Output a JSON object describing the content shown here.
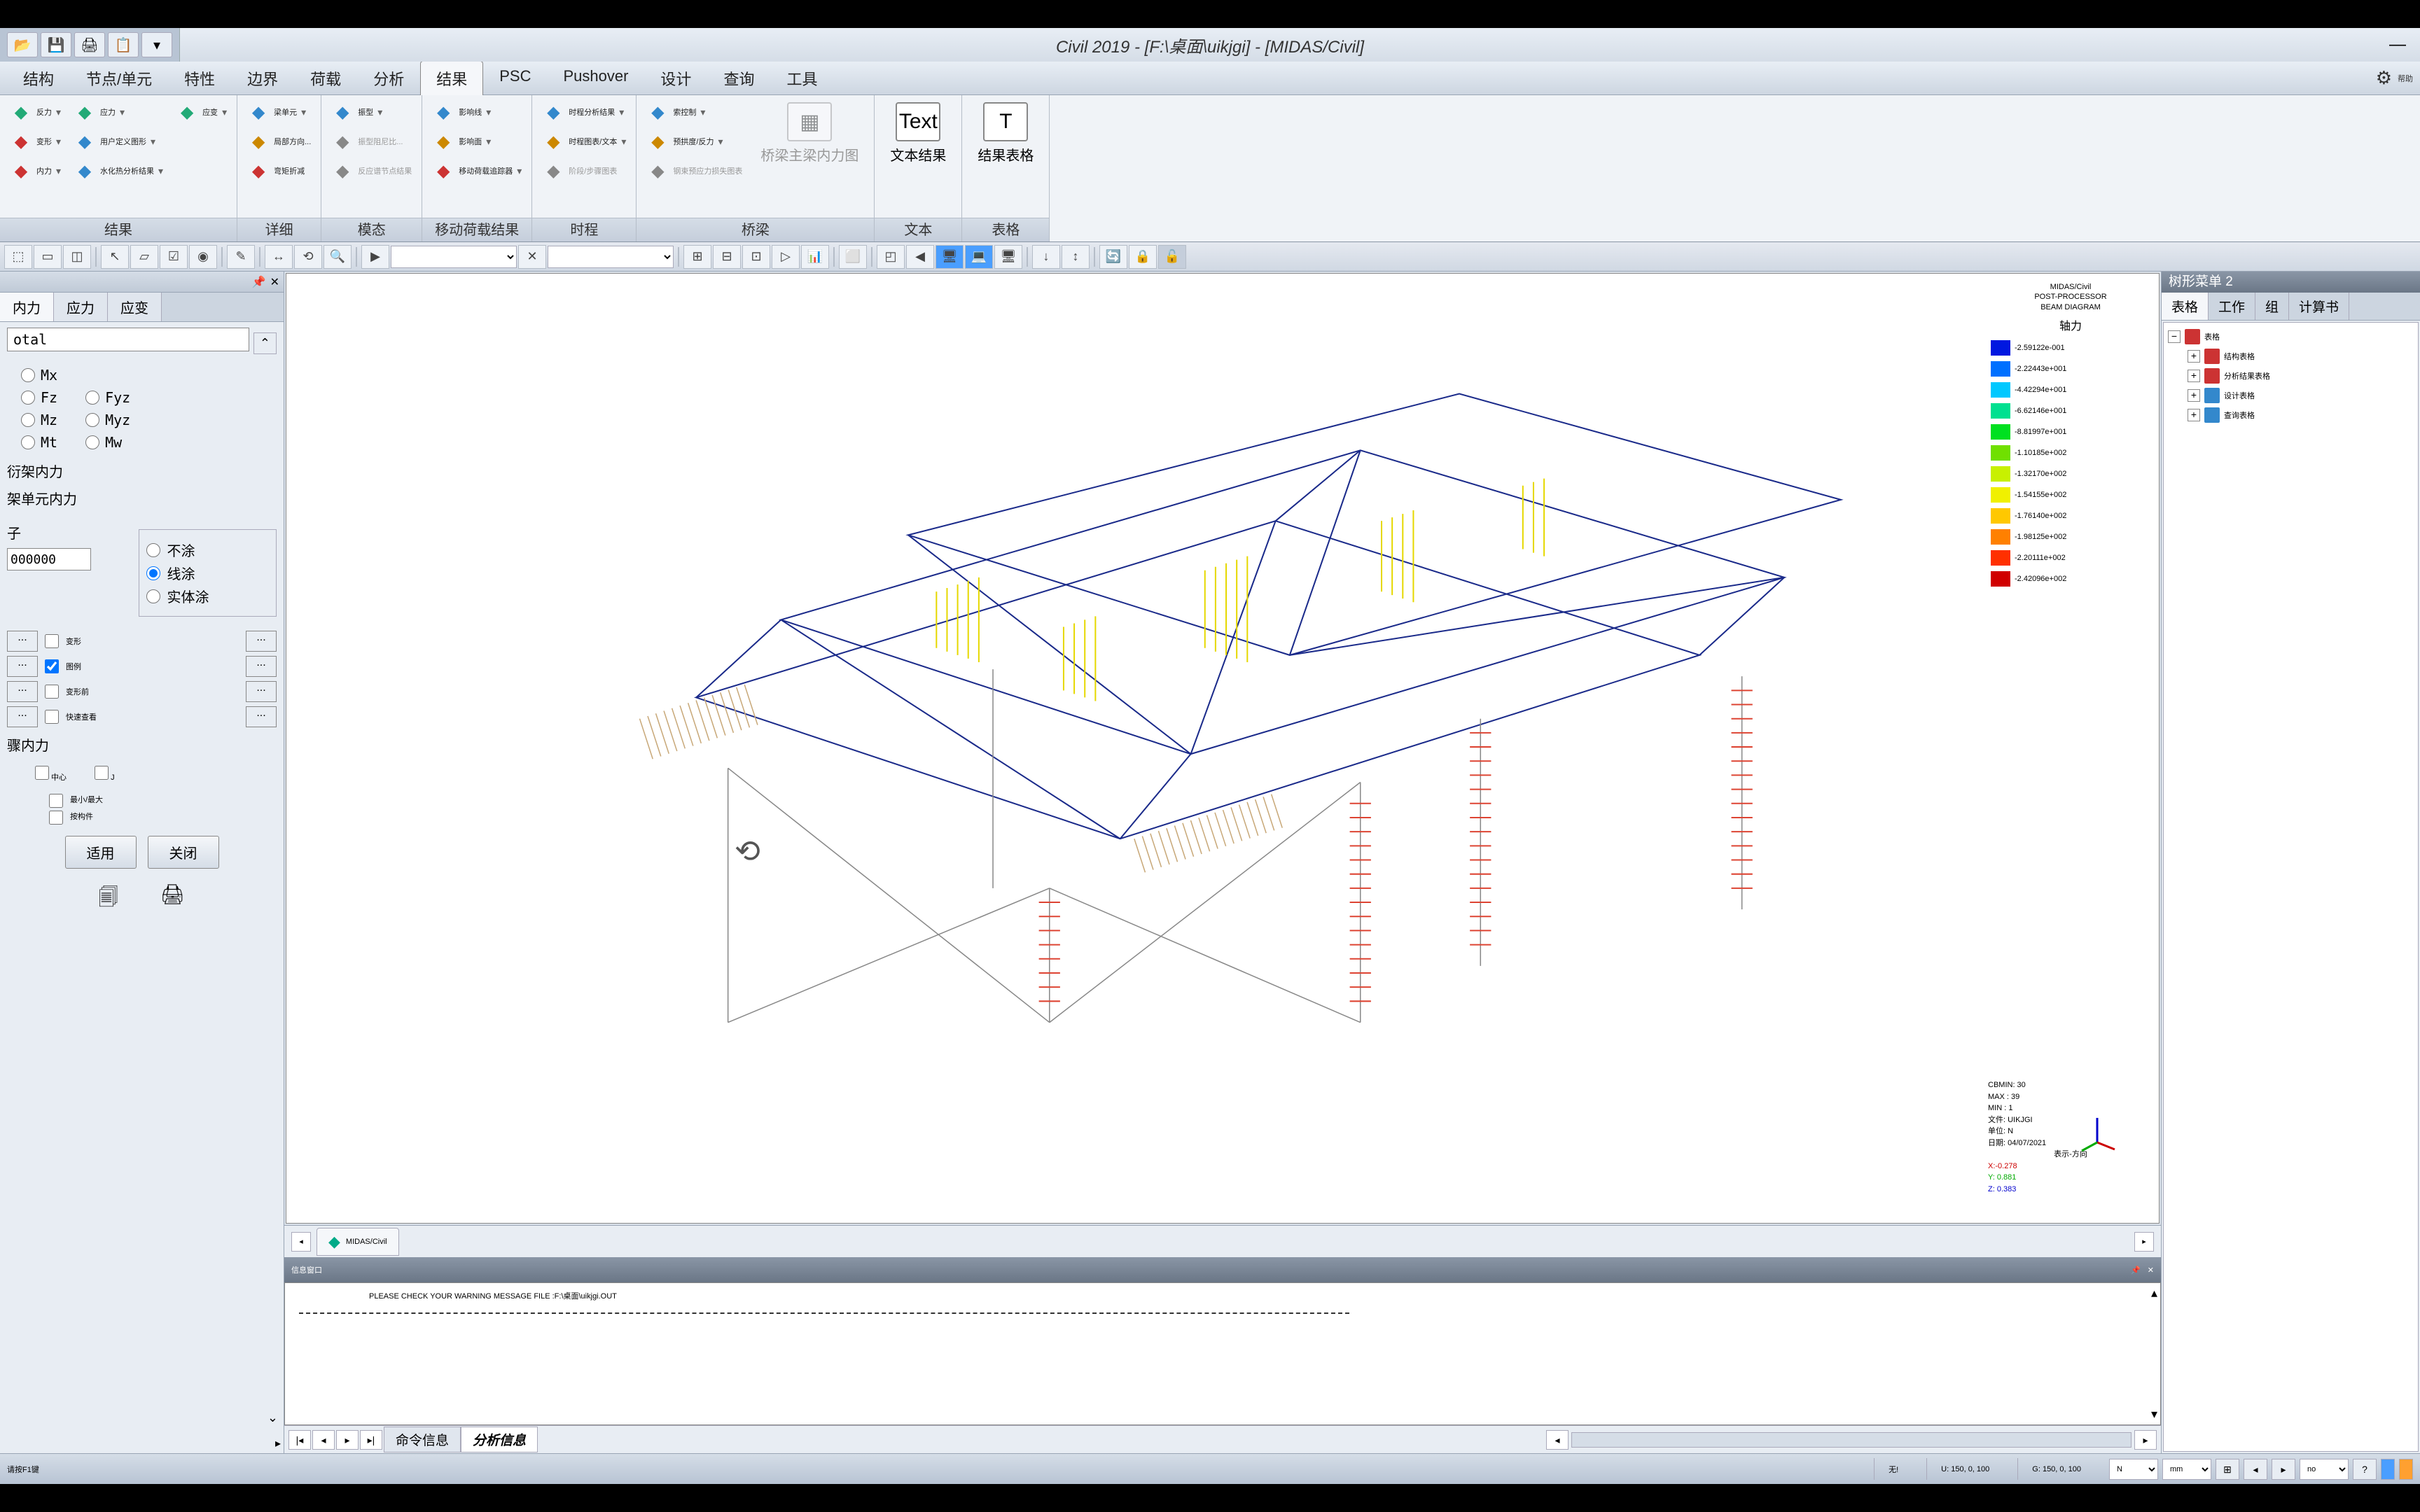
{
  "title": "Civil 2019 - [F:\\桌面\\uikjgi] - [MIDAS/Civil]",
  "menu": [
    "结构",
    "节点/单元",
    "特性",
    "边界",
    "荷载",
    "分析",
    "结果",
    "PSC",
    "Pushover",
    "设计",
    "查询",
    "工具"
  ],
  "menu_active": 6,
  "help_label": "帮助",
  "ribbon": {
    "groups": [
      {
        "label": "结果",
        "items": [
          {
            "col": [
              {
                "t": "反力",
                "dd": 1,
                "c": "#2a7"
              },
              {
                "t": "变形",
                "dd": 1,
                "c": "#c33"
              },
              {
                "t": "内力",
                "dd": 1,
                "c": "#c33"
              }
            ]
          },
          {
            "col": [
              {
                "t": "应力",
                "dd": 1,
                "c": "#2a7"
              },
              {
                "t": "用户定义图形",
                "dd": 1,
                "c": "#38c"
              },
              {
                "t": "水化热分析结果",
                "dd": 1,
                "c": "#38c"
              }
            ]
          },
          {
            "col": [
              {
                "t": "应变",
                "dd": 1,
                "c": "#2a7"
              }
            ]
          }
        ]
      },
      {
        "label": "详细",
        "items": [
          {
            "col": [
              {
                "t": "梁单元",
                "dd": 1,
                "c": "#38c"
              },
              {
                "t": "局部方向...",
                "c": "#c80"
              },
              {
                "t": "弯矩折减",
                "c": "#c33"
              }
            ]
          }
        ]
      },
      {
        "label": "模态",
        "items": [
          {
            "col": [
              {
                "t": "振型",
                "dd": 1,
                "c": "#38c"
              },
              {
                "t": "振型阻尼比...",
                "c": "#888",
                "dis": 1
              },
              {
                "t": "反应谱节点结果",
                "c": "#888",
                "dis": 1
              }
            ]
          }
        ]
      },
      {
        "label": "移动荷载结果",
        "items": [
          {
            "col": [
              {
                "t": "影响线",
                "dd": 1,
                "c": "#38c"
              },
              {
                "t": "影响面",
                "dd": 1,
                "c": "#c80"
              },
              {
                "t": "移动荷载追踪器",
                "dd": 1,
                "c": "#c33"
              }
            ]
          }
        ]
      },
      {
        "label": "时程",
        "items": [
          {
            "col": [
              {
                "t": "时程分析结果",
                "dd": 1,
                "c": "#38c"
              },
              {
                "t": "时程图表/文本",
                "dd": 1,
                "c": "#c80"
              },
              {
                "t": "阶段/步骤图表",
                "c": "#888",
                "dis": 1
              }
            ]
          }
        ]
      },
      {
        "label": "桥梁",
        "items": [
          {
            "col": [
              {
                "t": "索控制",
                "dd": 1,
                "c": "#38c"
              },
              {
                "t": "预拱度/反力",
                "dd": 1,
                "c": "#c80"
              },
              {
                "t": "钢束预应力损失图表",
                "c": "#888",
                "dis": 1
              }
            ]
          },
          {
            "big": {
              "t": "桥梁主梁内力图",
              "dis": 1
            }
          }
        ]
      },
      {
        "label": "文本",
        "items": [
          {
            "big": {
              "t": "文本结果",
              "ico": "Text"
            }
          }
        ]
      },
      {
        "label": "表格",
        "items": [
          {
            "big": {
              "t": "结果表格",
              "ico": "T"
            }
          }
        ]
      }
    ]
  },
  "left_panel": {
    "tabs": [
      "内力",
      "应力",
      "应变"
    ],
    "active_tab": 0,
    "combo": "otal",
    "radios": [
      [
        "Mx"
      ],
      [
        "Fz",
        "Fyz"
      ],
      [
        "Mz",
        "Myz"
      ],
      [
        "Mt",
        "Mw"
      ]
    ],
    "sec1": "衍架内力",
    "sec2": "架单元内力",
    "fill_input": "000000",
    "fill_opts": [
      "不涂",
      "线涂",
      "实体涂"
    ],
    "fill_selected": 1,
    "display": [
      [
        "变形",
        false
      ],
      [
        "图例",
        true
      ],
      [
        "变形前",
        false
      ],
      [
        "快速查看",
        false
      ]
    ],
    "sec3": "骤内力",
    "chk_center": "中心",
    "chk_j": "J",
    "chk_minmax": "最小/最大",
    "chk_bycomp": "按构件",
    "btn_apply": "适用",
    "btn_close": "关闭"
  },
  "viewport": {
    "doc_tab": "MIDAS/Civil",
    "legend": {
      "title1": "MIDAS/Civil",
      "title2": "POST-PROCESSOR",
      "title3": "BEAM DIAGRAM",
      "sub": "轴力",
      "rows": [
        {
          "c": "#0018e0",
          "v": "-2.59122e-001"
        },
        {
          "c": "#0070ff",
          "v": "-2.22443e+001"
        },
        {
          "c": "#00c8ff",
          "v": "-4.42294e+001"
        },
        {
          "c": "#00e090",
          "v": "-6.62146e+001"
        },
        {
          "c": "#00e020",
          "v": "-8.81997e+001"
        },
        {
          "c": "#70e000",
          "v": "-1.10185e+002"
        },
        {
          "c": "#c8f000",
          "v": "-1.32170e+002"
        },
        {
          "c": "#f0f000",
          "v": "-1.54155e+002"
        },
        {
          "c": "#ffc800",
          "v": "-1.76140e+002"
        },
        {
          "c": "#ff8000",
          "v": "-1.98125e+002"
        },
        {
          "c": "#ff3000",
          "v": "-2.20111e+002"
        },
        {
          "c": "#d00000",
          "v": "-2.42096e+002"
        }
      ]
    },
    "info": {
      "cbmin": "CBMIN: 30",
      "max": "MAX : 39",
      "min": "MIN : 1",
      "file": "文件: UIKJGI",
      "unit": "单位: N",
      "date": "日期: 04/07/2021",
      "view": "表示-方向",
      "x": "X:-0.278",
      "y": "Y: 0.881",
      "z": "Z: 0.383"
    }
  },
  "msg": {
    "header": "信息窗口",
    "text": "PLEASE CHECK YOUR WARNING MESSAGE FILE  :F:\\桌面\\uikjgi.OUT",
    "tabs": [
      "命令信息",
      "分析信息"
    ],
    "active": 1
  },
  "right_panel": {
    "header": "树形菜单 2",
    "tabs": [
      "表格",
      "工作",
      "组",
      "计算书"
    ],
    "active": 0,
    "tree": [
      {
        "t": "表格",
        "root": 1,
        "ico": "#c33"
      },
      {
        "t": "结构表格",
        "ico": "#c33"
      },
      {
        "t": "分析结果表格",
        "ico": "#c33"
      },
      {
        "t": "设计表格",
        "ico": "#38c"
      },
      {
        "t": "查询表格",
        "ico": "#38c"
      }
    ]
  },
  "status": {
    "hint": "请按F1键",
    "none": "无!",
    "u": "U: 150, 0, 100",
    "g": "G: 150, 0, 100",
    "n": "N",
    "mm": "mm",
    "no": "no"
  }
}
